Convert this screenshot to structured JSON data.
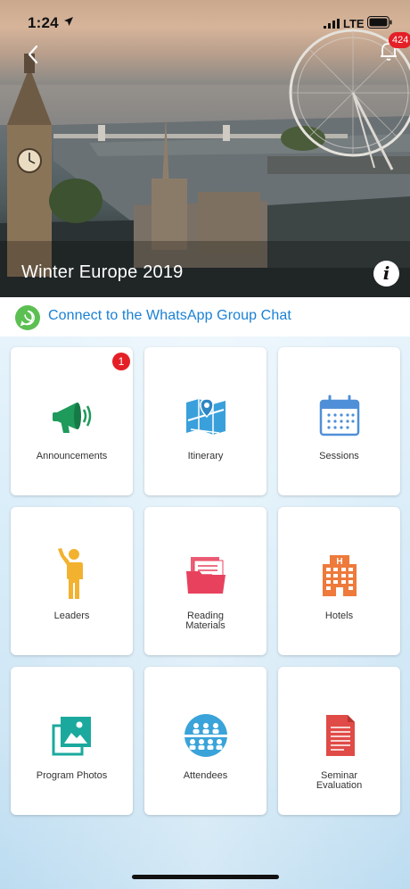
{
  "status_bar": {
    "time": "1:24",
    "network": "LTE"
  },
  "header": {
    "notification_count": "424",
    "title": "Winter Europe 2019"
  },
  "whatsapp": {
    "label": "Connect to the WhatsApp Group Chat"
  },
  "tiles": [
    {
      "label": "Announcements",
      "icon": "megaphone-icon",
      "badge": "1"
    },
    {
      "label": "Itinerary",
      "icon": "map-icon"
    },
    {
      "label": "Sessions",
      "icon": "calendar-icon"
    },
    {
      "label": "Leaders",
      "icon": "person-icon"
    },
    {
      "label": "Reading\nMaterials",
      "icon": "folder-icon"
    },
    {
      "label": "Hotels",
      "icon": "hotel-icon"
    },
    {
      "label": "Program Photos",
      "icon": "photos-icon"
    },
    {
      "label": "Attendees",
      "icon": "attendees-icon"
    },
    {
      "label": "Seminar\nEvaluation",
      "icon": "document-icon"
    }
  ],
  "colors": {
    "link_blue": "#1a80d4",
    "badge_red": "#e41f26",
    "whatsapp_green": "#5cbf52",
    "announce_green": "#1e9a5a",
    "itinerary_blue": "#3aa0db",
    "sessions_blue": "#4f8fd8",
    "leaders_yellow": "#f2b230",
    "reading_pink": "#e8415e",
    "hotels_orange": "#ee7a3b",
    "photos_teal": "#1ba99e",
    "attendees_blue": "#3aa3d9",
    "evaluation_red": "#e04b47"
  }
}
